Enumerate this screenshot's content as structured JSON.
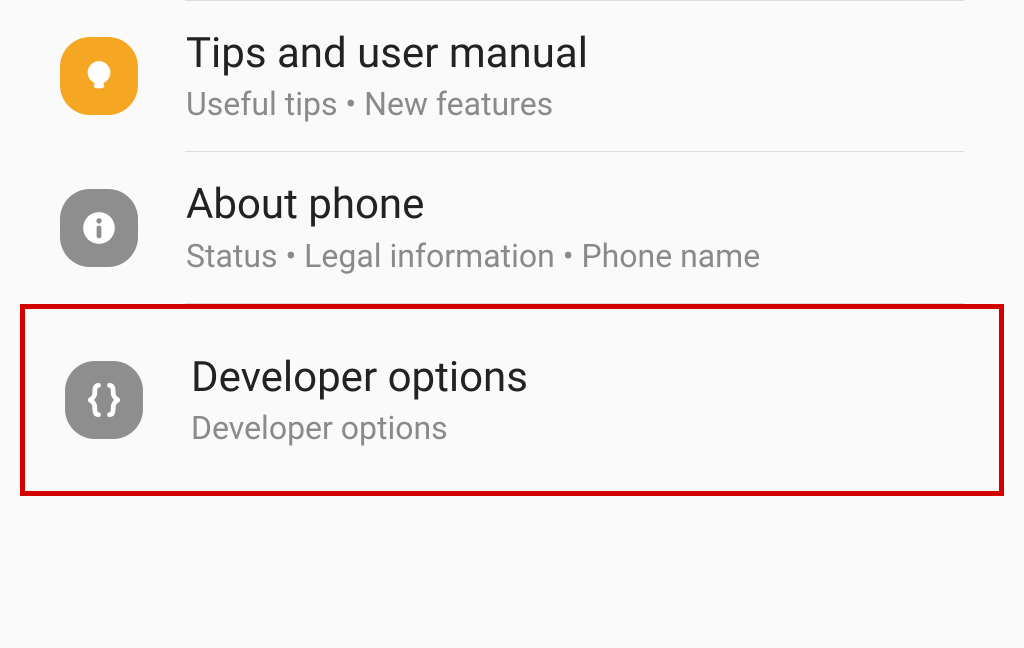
{
  "items": [
    {
      "title": "Tips and user manual",
      "subtitle": "Useful tips  •  New features"
    },
    {
      "title": "About phone",
      "subtitle": "Status  •  Legal information  •  Phone name"
    },
    {
      "title": "Developer options",
      "subtitle": "Developer options"
    }
  ]
}
